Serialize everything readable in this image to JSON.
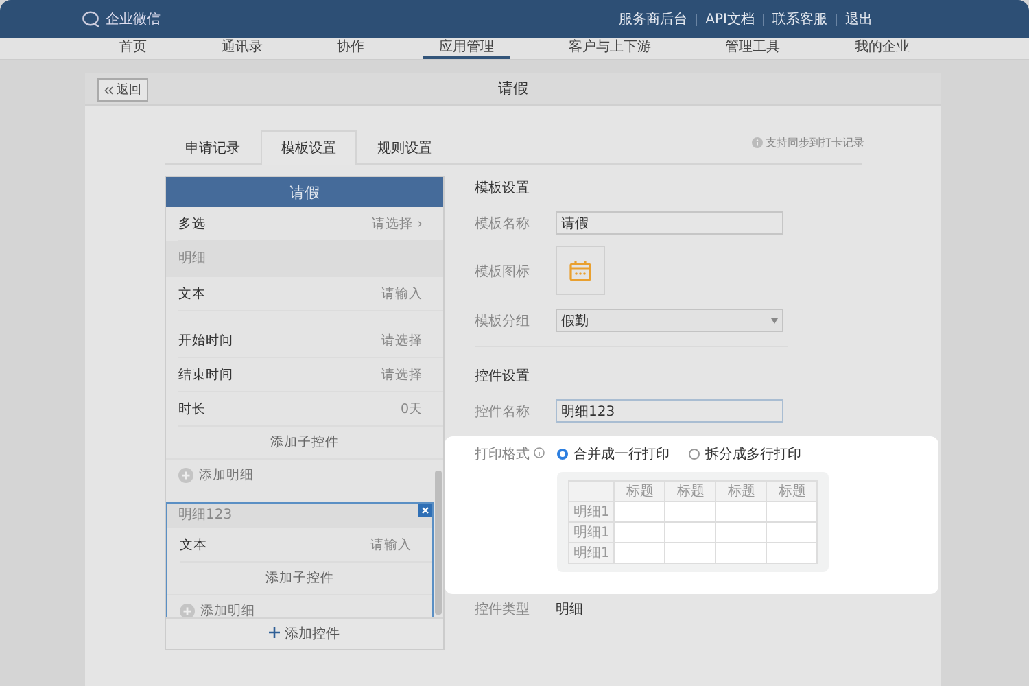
{
  "topbar": {
    "logo_text": "企业微信",
    "links": [
      "服务商后台",
      "API文档",
      "联系客服",
      "退出"
    ]
  },
  "nav": [
    {
      "label": "首页",
      "selected": false
    },
    {
      "label": "通讯录",
      "selected": false
    },
    {
      "label": "协作",
      "selected": false
    },
    {
      "label": "应用管理",
      "selected": true
    },
    {
      "label": "客户与上下游",
      "selected": false
    },
    {
      "label": "管理工具",
      "selected": false
    },
    {
      "label": "我的企业",
      "selected": false
    }
  ],
  "page": {
    "back": "返回",
    "title": "请假"
  },
  "tabs": [
    {
      "label": "申请记录",
      "selected": false
    },
    {
      "label": "模板设置",
      "selected": true
    },
    {
      "label": "规则设置",
      "selected": false
    }
  ],
  "sync_note": "支持同步到打卡记录",
  "preview": {
    "header": "请假",
    "items": [
      {
        "kind": "field",
        "label": "多选",
        "value": "请选择 ›"
      },
      {
        "kind": "section",
        "label": "明细"
      },
      {
        "kind": "field",
        "label": "文本",
        "value": "请输入"
      },
      {
        "kind": "spacer"
      },
      {
        "kind": "field",
        "label": "开始时间",
        "value": "请选择"
      },
      {
        "kind": "field",
        "label": "结束时间",
        "value": "请选择"
      },
      {
        "kind": "field",
        "label": "时长",
        "value": "0天"
      },
      {
        "kind": "action",
        "label": "添加子控件"
      },
      {
        "kind": "add",
        "label": "添加明细"
      },
      {
        "kind": "group",
        "label": "明细123",
        "selected": true,
        "children": [
          {
            "kind": "field",
            "label": "文本",
            "value": "请输入"
          },
          {
            "kind": "action",
            "label": "添加子控件"
          },
          {
            "kind": "add",
            "label": "添加明细"
          }
        ]
      }
    ],
    "footer": "添加控件"
  },
  "template_settings": {
    "title": "模板设置",
    "name_label": "模板名称",
    "name": "请假",
    "icon_label": "模板图标",
    "group_label": "模板分组",
    "group": "假勤"
  },
  "control_settings": {
    "title": "控件设置",
    "name_label": "控件名称",
    "name": "明细123",
    "print_label": "打印格式",
    "print_options": [
      {
        "label": "合并成一行打印",
        "selected": true
      },
      {
        "label": "拆分成多行打印",
        "selected": false
      }
    ],
    "print_preview": {
      "headers": [
        "标题",
        "标题",
        "标题",
        "标题"
      ],
      "rows": [
        "明细1",
        "明细1",
        "明细1"
      ]
    },
    "type_label": "控件类型",
    "type": "明细"
  }
}
